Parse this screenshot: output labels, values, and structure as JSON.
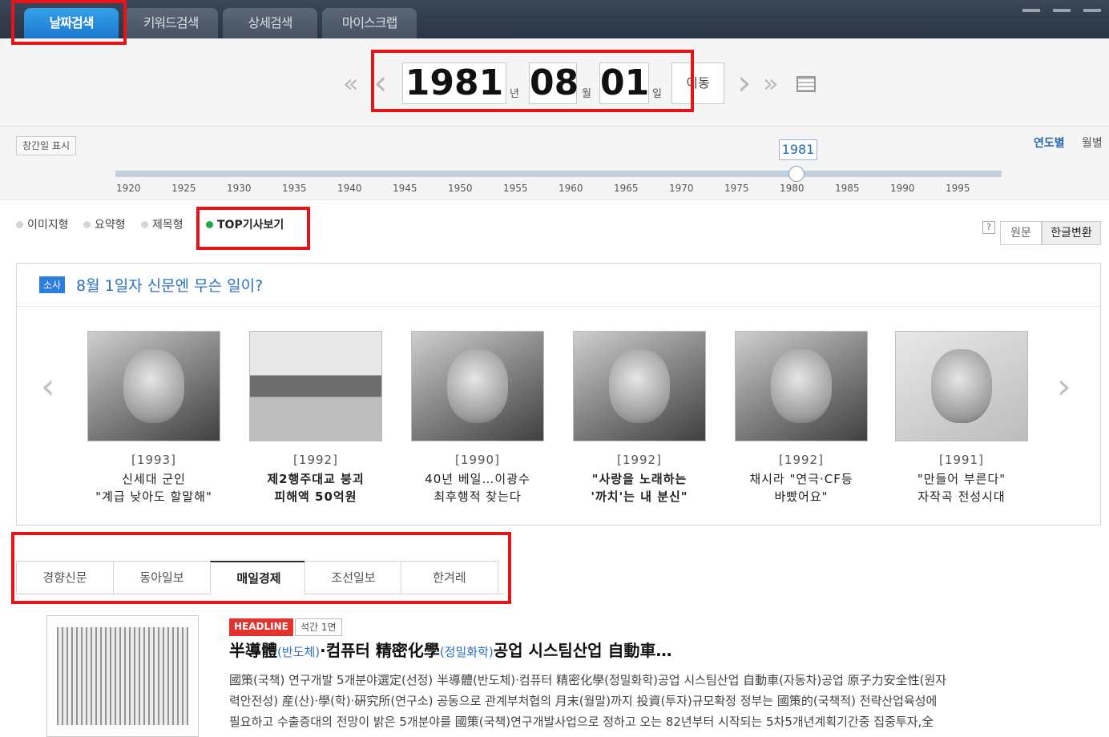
{
  "top_tabs": [
    {
      "label": "날짜검색",
      "active": true
    },
    {
      "label": "키워드검색",
      "active": false
    },
    {
      "label": "상세검색",
      "active": false
    },
    {
      "label": "마이스크랩",
      "active": false
    }
  ],
  "date_nav": {
    "prev_double": "«",
    "prev": "‹",
    "year": "1981",
    "year_unit": "년",
    "month": "08",
    "month_unit": "월",
    "day": "01",
    "day_unit": "일",
    "move_label": "이동",
    "next": "›",
    "next_double": "»"
  },
  "timeline": {
    "show_pub_date": "창간일 표시",
    "selected_year": "1981",
    "selected_fraction": 0.767,
    "view_by_year": "연도별",
    "view_by_month": "월별",
    "ticks": [
      "1920",
      "1925",
      "1930",
      "1935",
      "1940",
      "1945",
      "1950",
      "1955",
      "1960",
      "1965",
      "1970",
      "1975",
      "1980",
      "1985",
      "1990",
      "1995"
    ]
  },
  "view_modes": [
    {
      "label": "이미지형",
      "selected": false
    },
    {
      "label": "요약형",
      "selected": false
    },
    {
      "label": "제목형",
      "selected": false
    },
    {
      "label": "TOP기사보기",
      "selected": true
    }
  ],
  "text_mode": {
    "help": "?",
    "original": "원문",
    "hangul": "한글변환"
  },
  "top_news": {
    "badge": "소사",
    "title": "8월 1일자 신문엔 무슨 일이?",
    "prev": "‹",
    "next": "›",
    "stories": [
      {
        "year": "[1993]",
        "line1": "신세대 군인",
        "line2": "\"계급 낮아도 할말해\"",
        "bold": false
      },
      {
        "year": "[1992]",
        "line1": "제2행주대교 붕괴",
        "line2": "피해액 50억원",
        "bold": true
      },
      {
        "year": "[1990]",
        "line1": "40년 베일…이광수",
        "line2": "최후행적 찾는다",
        "bold": false
      },
      {
        "year": "[1992]",
        "line1": "\"사랑을 노래하는",
        "line2": "'까치'는 내 분신\"",
        "bold": true
      },
      {
        "year": "[1992]",
        "line1": "채시라 \"연극·CF등",
        "line2": "바빴어요\"",
        "bold": false
      },
      {
        "year": "[1991]",
        "line1": "\"만들어 부른다\"",
        "line2": "자작곡 전성시대",
        "bold": false
      }
    ]
  },
  "paper_tabs": [
    {
      "label": "경향신문",
      "active": false
    },
    {
      "label": "동아일보",
      "active": false
    },
    {
      "label": "매일경제",
      "active": true
    },
    {
      "label": "조선일보",
      "active": false
    },
    {
      "label": "한겨레",
      "active": false
    }
  ],
  "article": {
    "tag_headline": "HEADLINE",
    "tag_page": "석간 1면",
    "title_a": "半導體",
    "title_b": "(반도체)",
    "title_c": "·컴퓨터 精密化學",
    "title_d": "(정밀화학)",
    "title_e": "공업 시스팀산업 自動車…",
    "body_line1": "國策(국책) 연구개발 5개분야選定(선정) 半導體(반도체)·컴퓨터 精密化學(정밀화학)공업 시스팀산업 自動車(자동차)공업 原子力安全性(원자",
    "body_line2": "력안전성) 産(산)·學(학)·硏究所(연구소) 공동으로 관계부처협의 月末(월말)까지 投資(투자)규모확정 정부는 國策的(국책적) 전략산업육성에",
    "body_line3": "필요하고 수출증대의 전망이 밝은 5개분야를 國策(국책)연구개발사업으로 정하고 오는 82년부터 시작되는 5차5개년계획기간중 집중투자,全"
  }
}
